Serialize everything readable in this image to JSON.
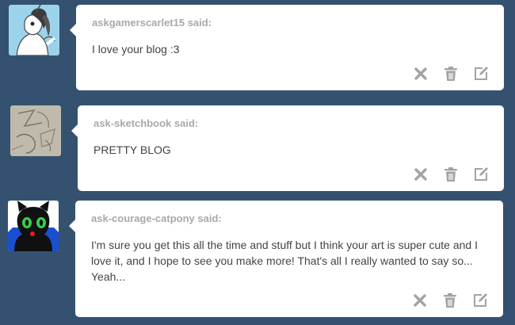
{
  "asks": [
    {
      "asker": "askgamerscarlet15 said:",
      "question": "I love your blog :3",
      "avatar_icon": "white-pony-avatar-icon"
    },
    {
      "asker": "ask-sketchbook said:",
      "question": "PRETTY BLOG",
      "avatar_icon": "sketch-avatar-icon"
    },
    {
      "asker": "ask-courage-catpony said:",
      "question": "I'm sure you get this all the time and stuff but I think your art is super cute and I love it, and I hope to see you make more! That's all I really wanted to say so... Yeah...",
      "avatar_icon": "black-cat-pony-avatar-icon"
    }
  ],
  "actions": {
    "delete_icon": "close-icon",
    "trash_icon": "trash-icon",
    "edit_icon": "edit-icon"
  },
  "colors": {
    "background": "#34526f",
    "card": "#ffffff",
    "asker_text": "#a9a9a9",
    "question_text": "#444444",
    "icon": "#a3a3a3"
  }
}
